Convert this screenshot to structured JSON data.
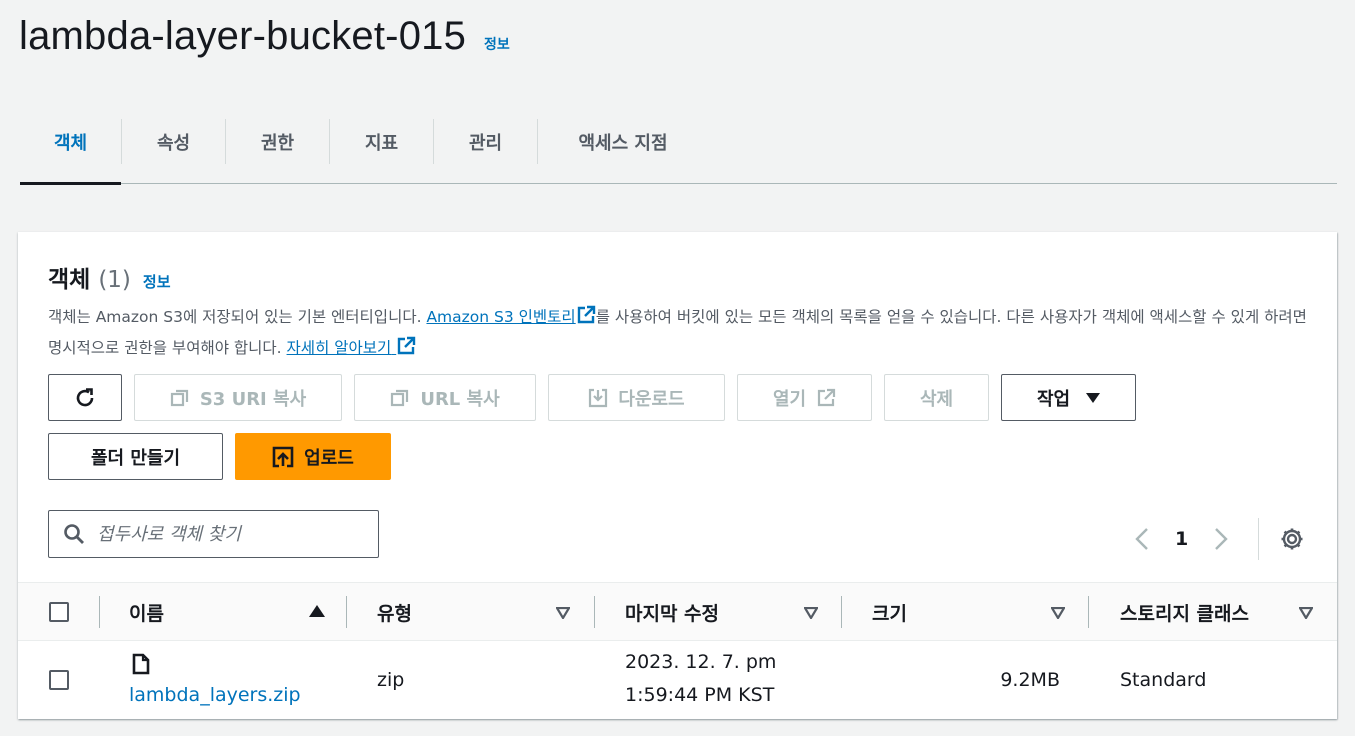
{
  "header": {
    "title": "lambda-layer-bucket-015",
    "info": "정보"
  },
  "tabs": [
    {
      "label": "객체",
      "active": true
    },
    {
      "label": "속성"
    },
    {
      "label": "권한"
    },
    {
      "label": "지표"
    },
    {
      "label": "관리"
    },
    {
      "label": "액세스 지점"
    }
  ],
  "objects": {
    "title": "객체",
    "count": "(1)",
    "info": "정보",
    "desc_part1": "객체는 Amazon S3에 저장되어 있는 기본 엔터티입니다. ",
    "desc_link1": "Amazon S3 인벤토리",
    "desc_part2": "를 사용하여 버킷에 있는 모든 객체의 목록을 얻을 수 있습니다. 다른 사용자가 객체에 액세스할 수 있게 하려면 명시적으로 권한을 부여해야 합니다. ",
    "desc_link2": "자세히 알아보기"
  },
  "toolbar": {
    "copy_s3_uri": "S3 URI 복사",
    "copy_url": "URL 복사",
    "download": "다운로드",
    "open": "열기",
    "delete": "삭제",
    "actions": "작업",
    "create_folder": "폴더 만들기",
    "upload": "업로드"
  },
  "search": {
    "placeholder": "접두사로 객체 찾기"
  },
  "pagination": {
    "current_page": "1"
  },
  "table": {
    "columns": [
      "이름",
      "유형",
      "마지막 수정",
      "크기",
      "스토리지 클래스"
    ],
    "rows": [
      {
        "name": "lambda_layers.zip",
        "type": "zip",
        "modified_line1": "2023. 12. 7. pm",
        "modified_line2": "1:59:44 PM KST",
        "size": "9.2MB",
        "storage_class": "Standard"
      }
    ]
  },
  "colors": {
    "link": "#0073bb",
    "primary": "#ff9900",
    "text": "#16191f"
  }
}
